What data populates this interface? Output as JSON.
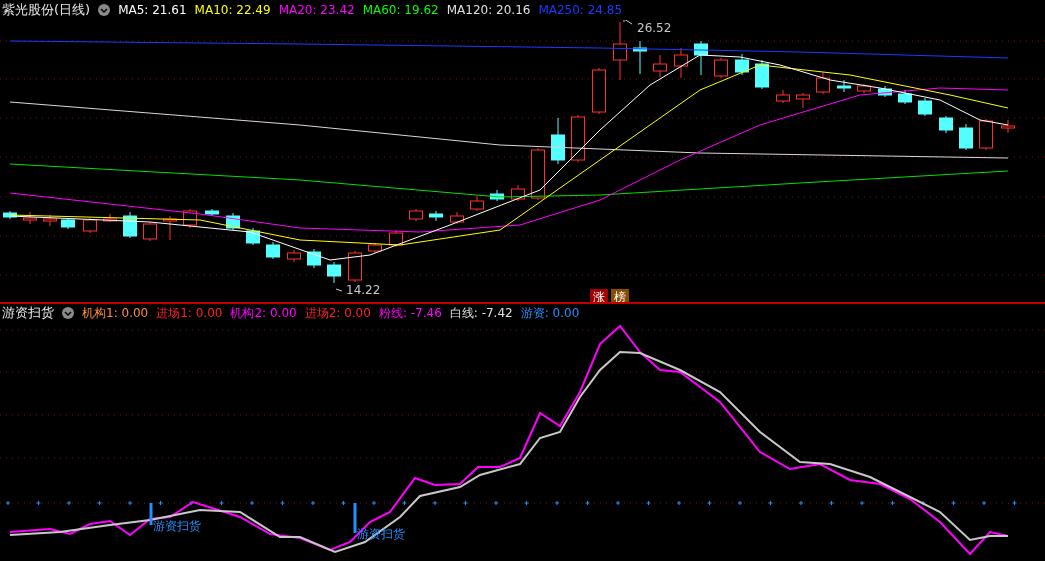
{
  "price_panel": {
    "title": "紫光股份(日线)",
    "indicators": [
      {
        "label": "MA5: 21.61",
        "color": "#ffffff"
      },
      {
        "label": "MA10: 22.49",
        "color": "#ffff00"
      },
      {
        "label": "MA20: 23.42",
        "color": "#ff00ff"
      },
      {
        "label": "MA60: 19.62",
        "color": "#00ff00"
      },
      {
        "label": "MA120: 20.16",
        "color": "#e0e0e0"
      },
      {
        "label": "MA250: 24.85",
        "color": "#1a3cff"
      }
    ],
    "high_label": "26.52",
    "low_label": "14.22",
    "badges": [
      {
        "text": "涨",
        "color": "#a00000"
      },
      {
        "text": "榜",
        "color": "#8a4a00"
      }
    ]
  },
  "indicator_panel": {
    "title": "游资扫货",
    "indicators": [
      {
        "label": "机构1: 0.00",
        "color": "#ff8c3c"
      },
      {
        "label": "进场1: 0.00",
        "color": "#ff2020"
      },
      {
        "label": "机构2: 0.00",
        "color": "#ff00ff"
      },
      {
        "label": "进场2: 0.00",
        "color": "#ff2020"
      },
      {
        "label": "粉线: -7.46",
        "color": "#ff00ff"
      },
      {
        "label": "白线: -7.42",
        "color": "#e0e0e0"
      },
      {
        "label": "游资: 0.00",
        "color": "#1e90ff"
      }
    ],
    "signals": [
      "游资扫货",
      "游资扫货"
    ]
  }
}
